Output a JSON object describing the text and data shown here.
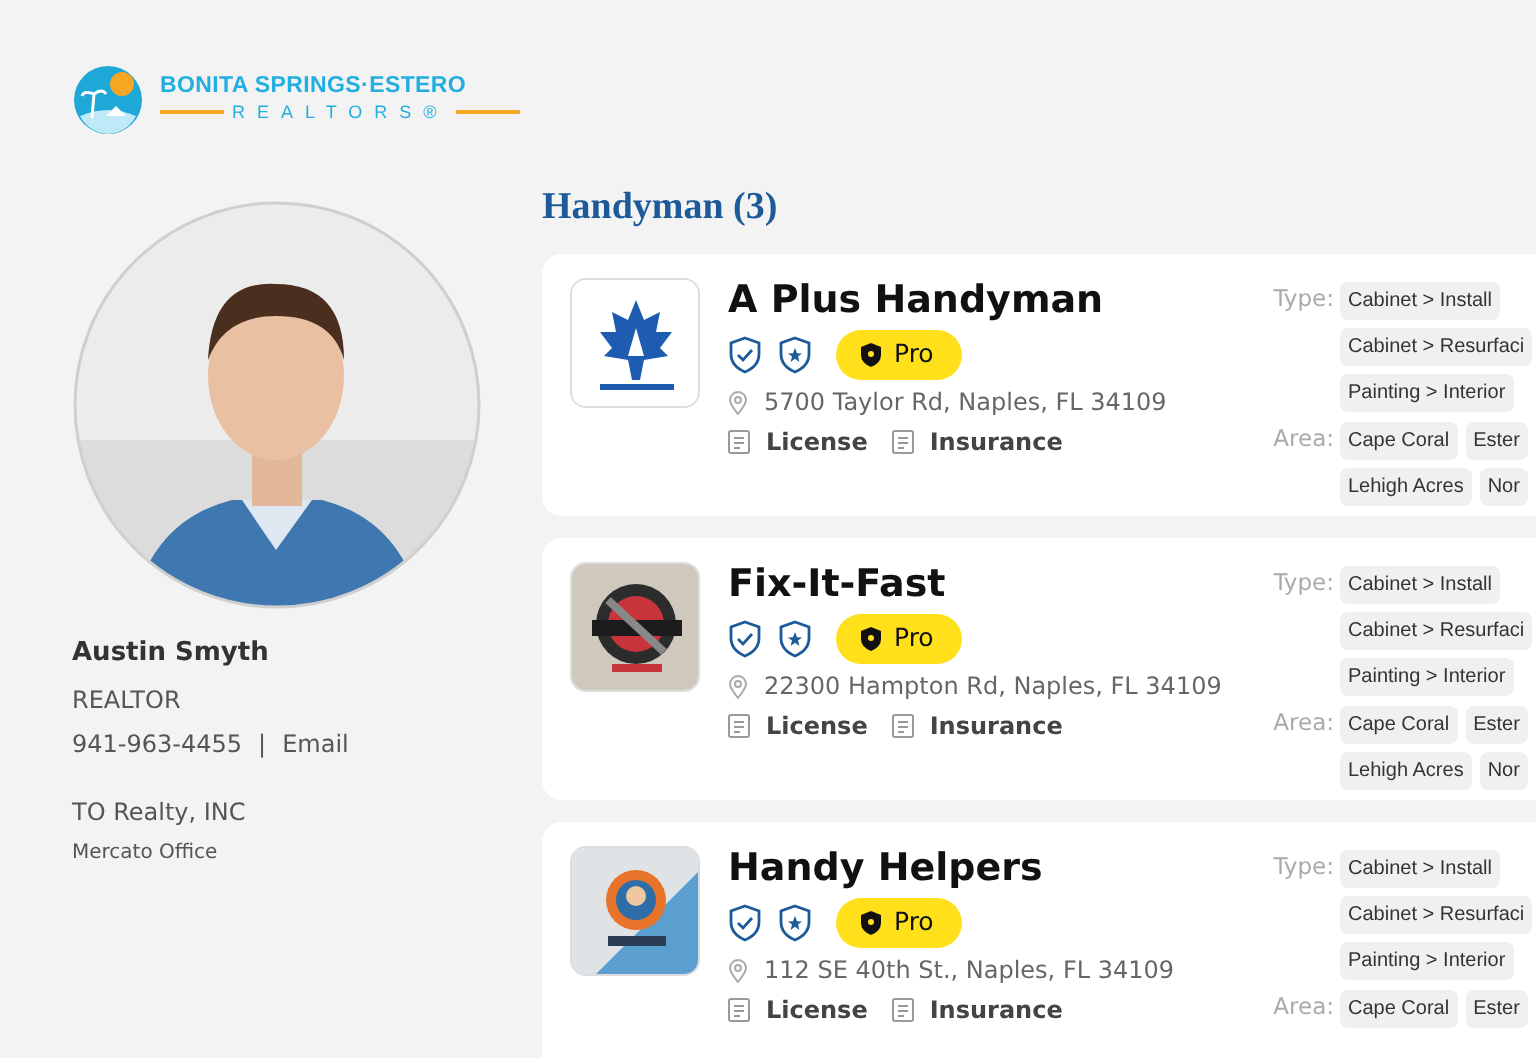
{
  "brand": {
    "name": "BONITA SPRINGS·ESTERO",
    "tagline": "REALTORS®"
  },
  "agent": {
    "photo": {
      "kind": "picture"
    },
    "name": "Austin Smyth",
    "title": "REALTOR",
    "phone": "941-963-4455",
    "separator": "|",
    "email": "Email",
    "company": "TO Realty, INC",
    "office": "Mercato Office"
  },
  "section": {
    "title": "Handyman (3)"
  },
  "listings": [
    {
      "logo": {
        "kind": "picture"
      },
      "name": "A Plus Handyman",
      "badge": "Pro",
      "address": "5700 Taylor Rd, Naples, FL 34109",
      "documents": [
        "License",
        "Insurance"
      ],
      "type_label": "Type:",
      "types": [
        "Cabinet > Install",
        "Cabinet > Resurfaci",
        "Painting > Interior"
      ],
      "area_label": "Area:",
      "areas": [
        "Cape Coral",
        "Ester",
        "Lehigh Acres",
        "Nor"
      ]
    },
    {
      "logo": {
        "kind": "picture"
      },
      "name": "Fix-It-Fast",
      "badge": "Pro",
      "address": "22300 Hampton Rd, Naples, FL 34109",
      "documents": [
        "License",
        "Insurance"
      ],
      "type_label": "Type:",
      "types": [
        "Cabinet > Install",
        "Cabinet > Resurfaci",
        "Painting > Interior"
      ],
      "area_label": "Area:",
      "areas": [
        "Cape Coral",
        "Ester",
        "Lehigh Acres",
        "Nor"
      ]
    },
    {
      "logo": {
        "kind": "picture"
      },
      "name": "Handy Helpers",
      "badge": "Pro",
      "address": "112 SE 40th St., Naples, FL 34109",
      "documents": [
        "License",
        "Insurance"
      ],
      "type_label": "Type:",
      "types": [
        "Cabinet > Install",
        "Cabinet > Resurfaci",
        "Painting > Interior"
      ],
      "area_label": "Area:",
      "areas": [
        "Cape Coral",
        "Ester"
      ]
    }
  ]
}
